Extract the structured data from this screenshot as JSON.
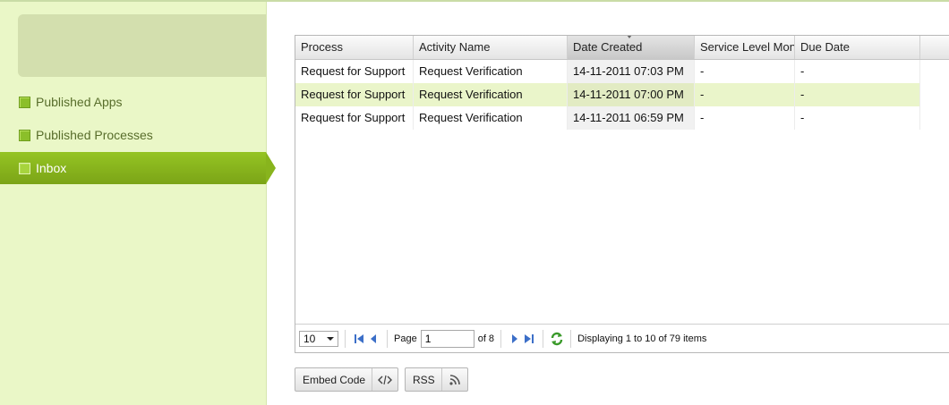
{
  "sidebar": {
    "items": [
      {
        "label": "Published Apps"
      },
      {
        "label": "Published Processes"
      },
      {
        "label": "Inbox"
      }
    ]
  },
  "grid": {
    "columns": [
      "Process",
      "Activity Name",
      "Date Created",
      "Service Level Mon",
      "Due Date"
    ],
    "rows": [
      [
        "Request for Support",
        "Request Verification",
        "14-11-2011 07:03 PM",
        "-",
        "-"
      ],
      [
        "Request for Support",
        "Request Verification",
        "14-11-2011 07:00 PM",
        "-",
        "-"
      ],
      [
        "Request for Support",
        "Request Verification",
        "14-11-2011 06:59 PM",
        "-",
        "-"
      ]
    ]
  },
  "pager": {
    "page_size": "10",
    "page_label": "Page",
    "page_value": "1",
    "of_text": "of 8",
    "display_text": "Displaying 1 to 10 of 79 items"
  },
  "buttons": {
    "embed_label": "Embed Code",
    "rss_label": "RSS"
  },
  "colors": {
    "accent": "#88b41d",
    "sidebar_bg": "#eaf7c7",
    "row_alt": "#eaf5ca"
  }
}
